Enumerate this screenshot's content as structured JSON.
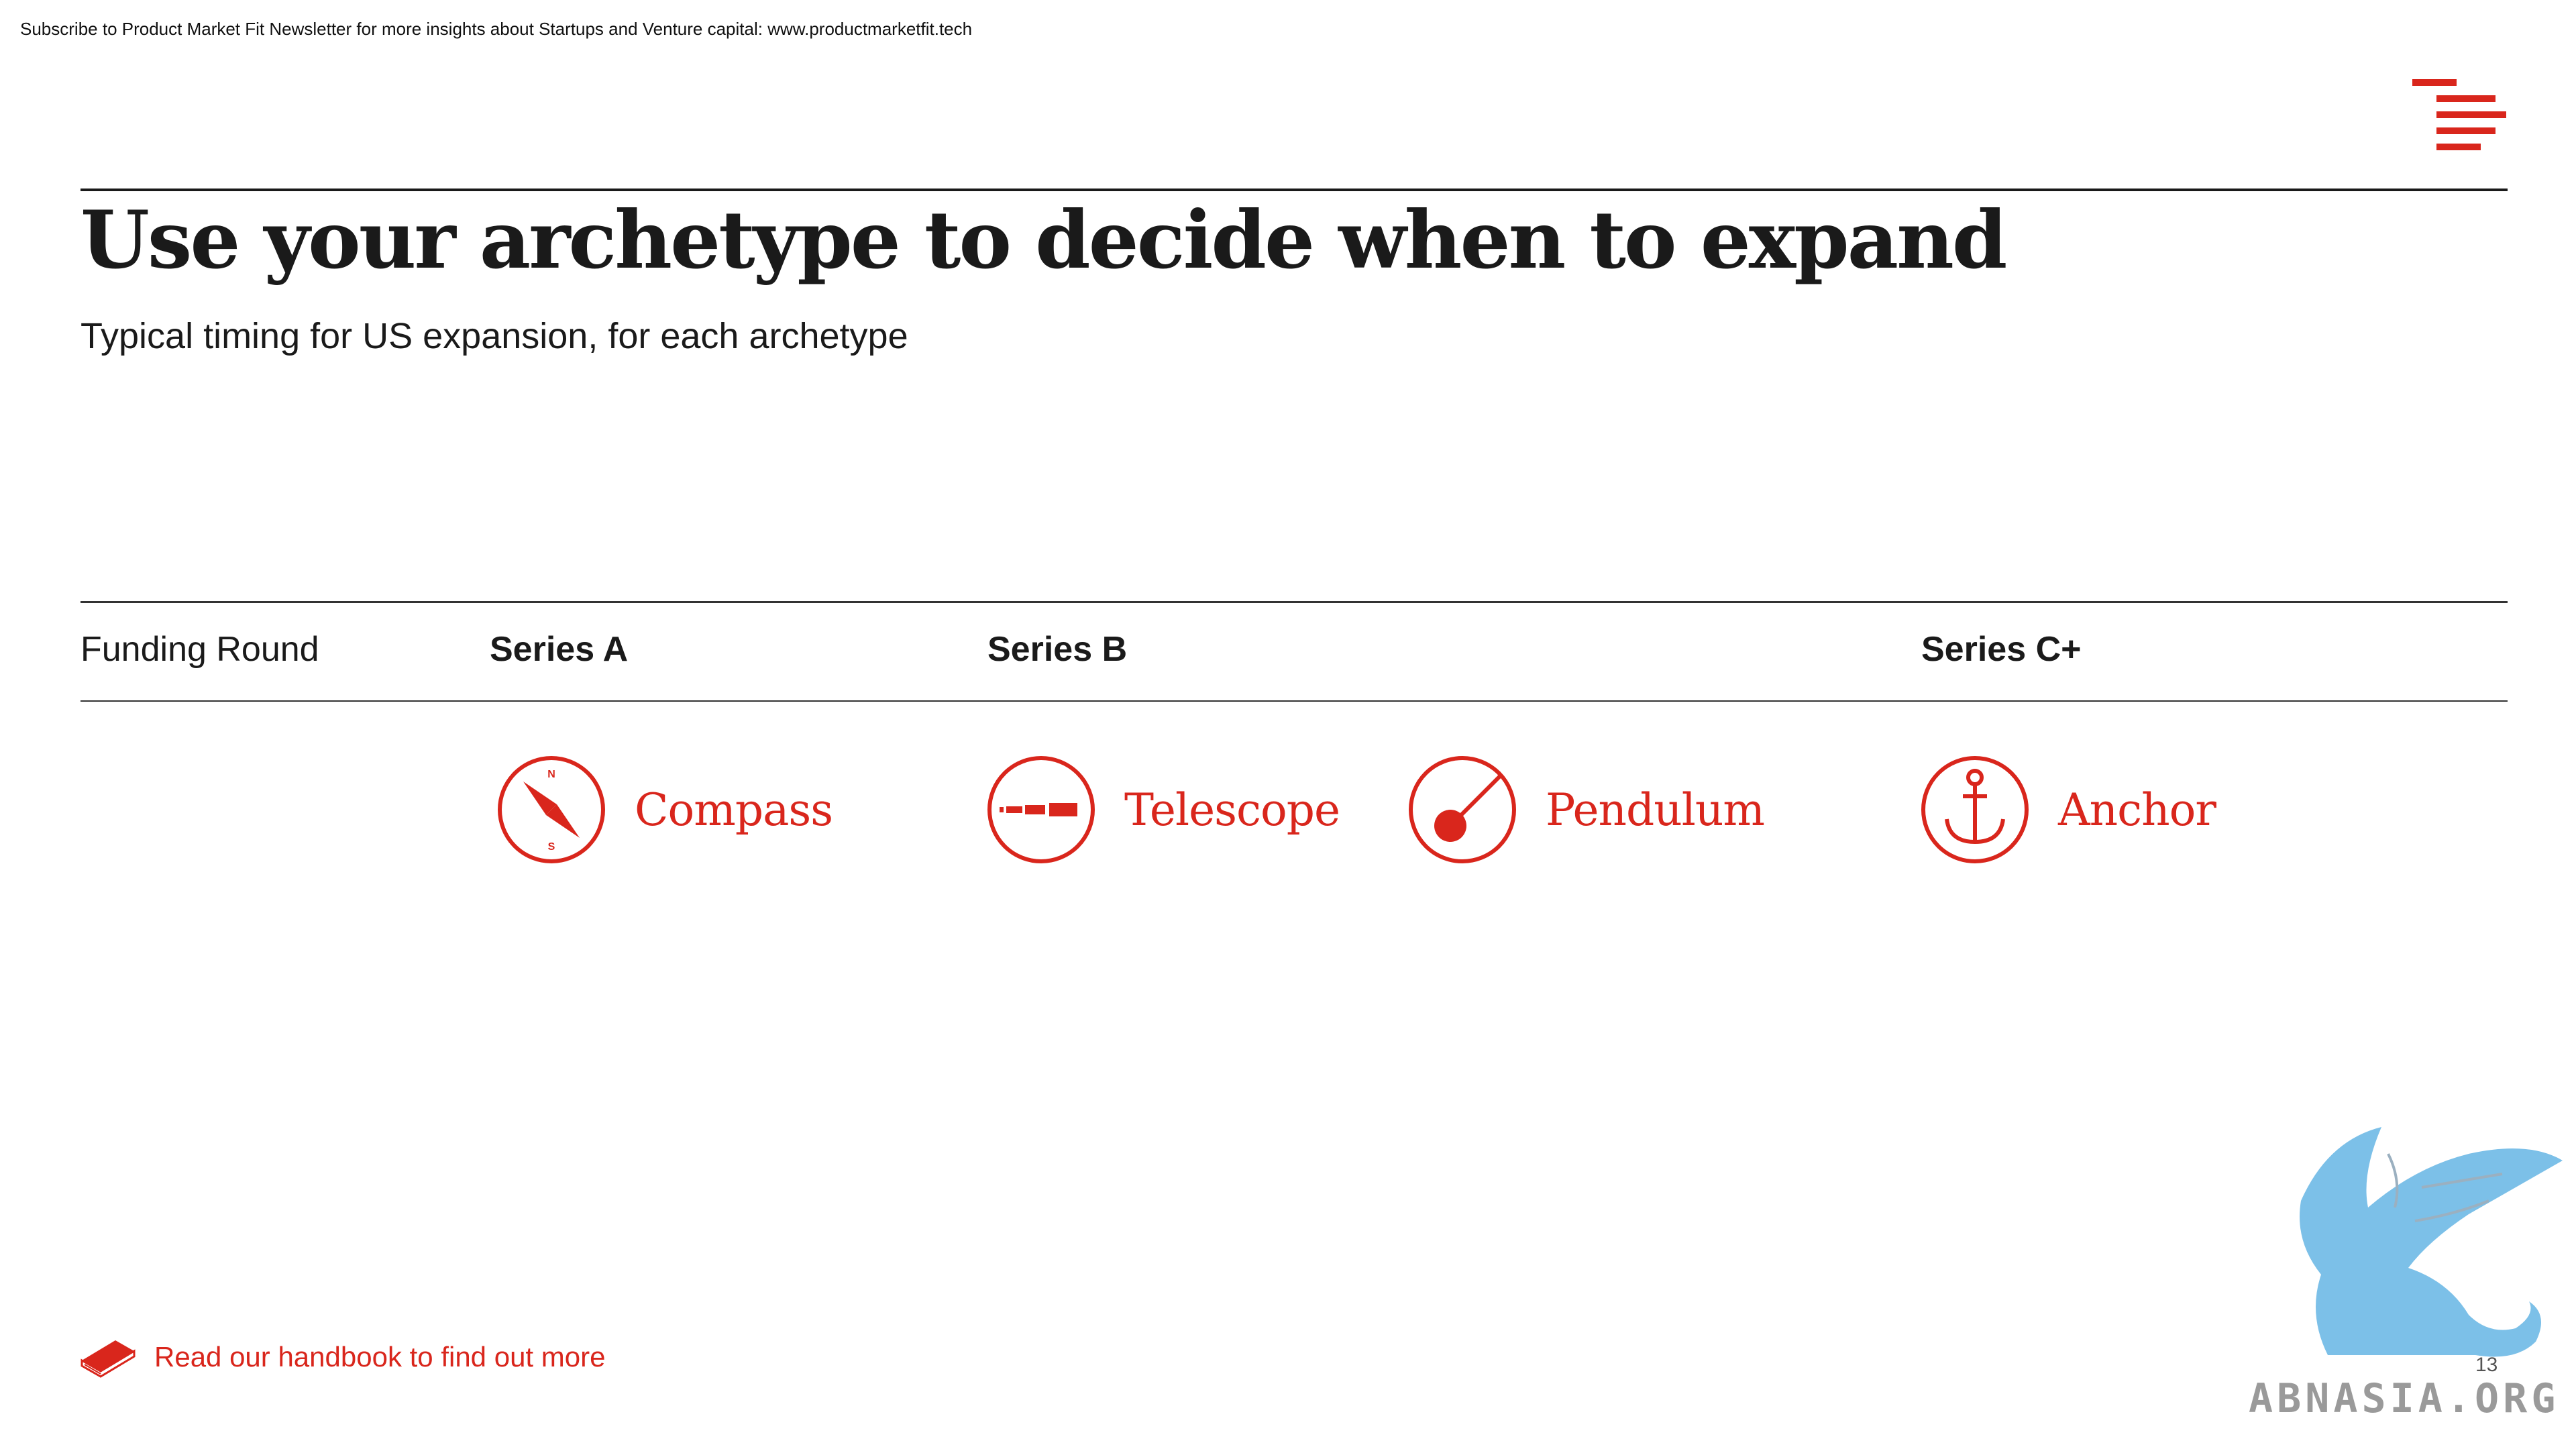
{
  "header": {
    "newsletter_text": "Subscribe to Product Market Fit Newsletter for more insights about Startups and Venture capital:  www.productmarketfit.tech",
    "logo_icon": "stacked-red-bars-logo"
  },
  "slide": {
    "title": "Use your archetype to decide when to expand",
    "subtitle": "Typical timing for US expansion, for each archetype"
  },
  "table": {
    "row_header": "Funding Round",
    "rounds": [
      "Series A",
      "Series B",
      "Series C+"
    ],
    "archetypes": [
      {
        "name": "Compass",
        "icon": "compass-icon",
        "compass_n": "N",
        "compass_s": "S"
      },
      {
        "name": "Telescope",
        "icon": "telescope-icon"
      },
      {
        "name": "Pendulum",
        "icon": "pendulum-icon"
      },
      {
        "name": "Anchor",
        "icon": "anchor-icon"
      }
    ]
  },
  "footer": {
    "handbook_text": "Read our handbook to find out more",
    "handbook_icon": "book-icon",
    "page_number": "13",
    "watermark_text": "ABNASIA.ORG",
    "watermark_icon": "griffin-icon"
  },
  "colors": {
    "accent": "#d9261c",
    "text": "#1a1a1a",
    "watermark": "#7cc0e8"
  }
}
